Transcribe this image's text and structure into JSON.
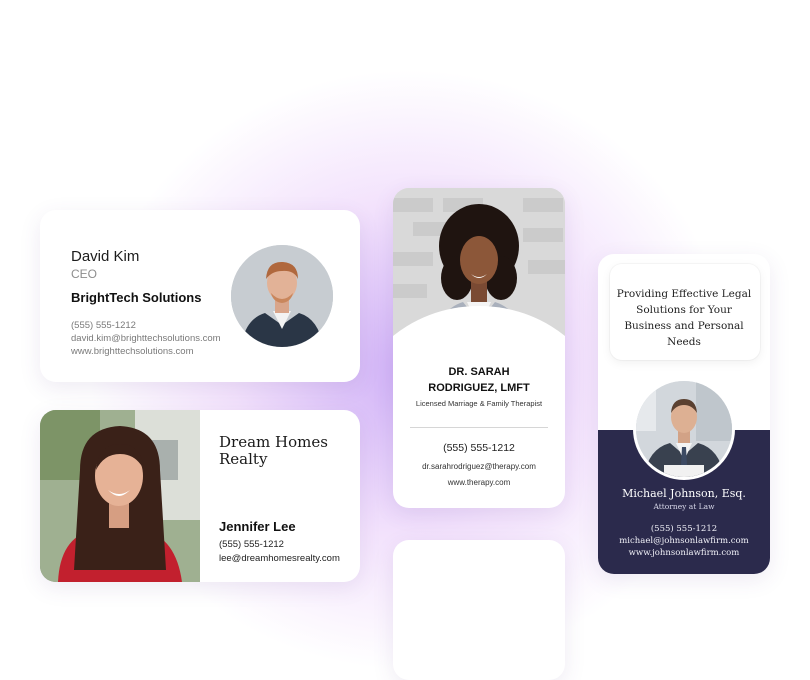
{
  "cards": {
    "kim": {
      "name": "David Kim",
      "title": "CEO",
      "company": "BrightTech Solutions",
      "phone": "(555) 555-1212",
      "email": "david.kim@brighttechsolutions.com",
      "website": "www.brighttechsolutions.com",
      "avatar_icon": "person-portrait-icon"
    },
    "lee": {
      "company": "Dream Homes Realty",
      "name": "Jennifer Lee",
      "phone": "(555) 555-1212",
      "email": "lee@dreamhomesrealty.com",
      "photo_icon": "person-portrait-icon"
    },
    "rodriguez": {
      "name_line1": "DR. SARAH",
      "name_line2": "RODRIGUEZ, LMFT",
      "role": "Licensed Marriage & Family Therapist",
      "phone": "(555) 555-1212",
      "email": "dr.sarahrodriguez@therapy.com",
      "website": "www.therapy.com",
      "photo_icon": "person-portrait-icon"
    },
    "johnson": {
      "tagline": "Providing Effective Legal Solutions for Your Business and Personal Needs",
      "name": "Michael Johnson, Esq.",
      "role": "Attorney at Law",
      "phone": "(555) 555-1212",
      "email": "michael@johnsonlawfirm.com",
      "website": "www.johnsonlawfirm.com",
      "avatar_icon": "person-portrait-icon"
    }
  },
  "colors": {
    "navy": "#2b2a4c",
    "glow": "#a870f0",
    "card_bg": "#ffffff"
  }
}
